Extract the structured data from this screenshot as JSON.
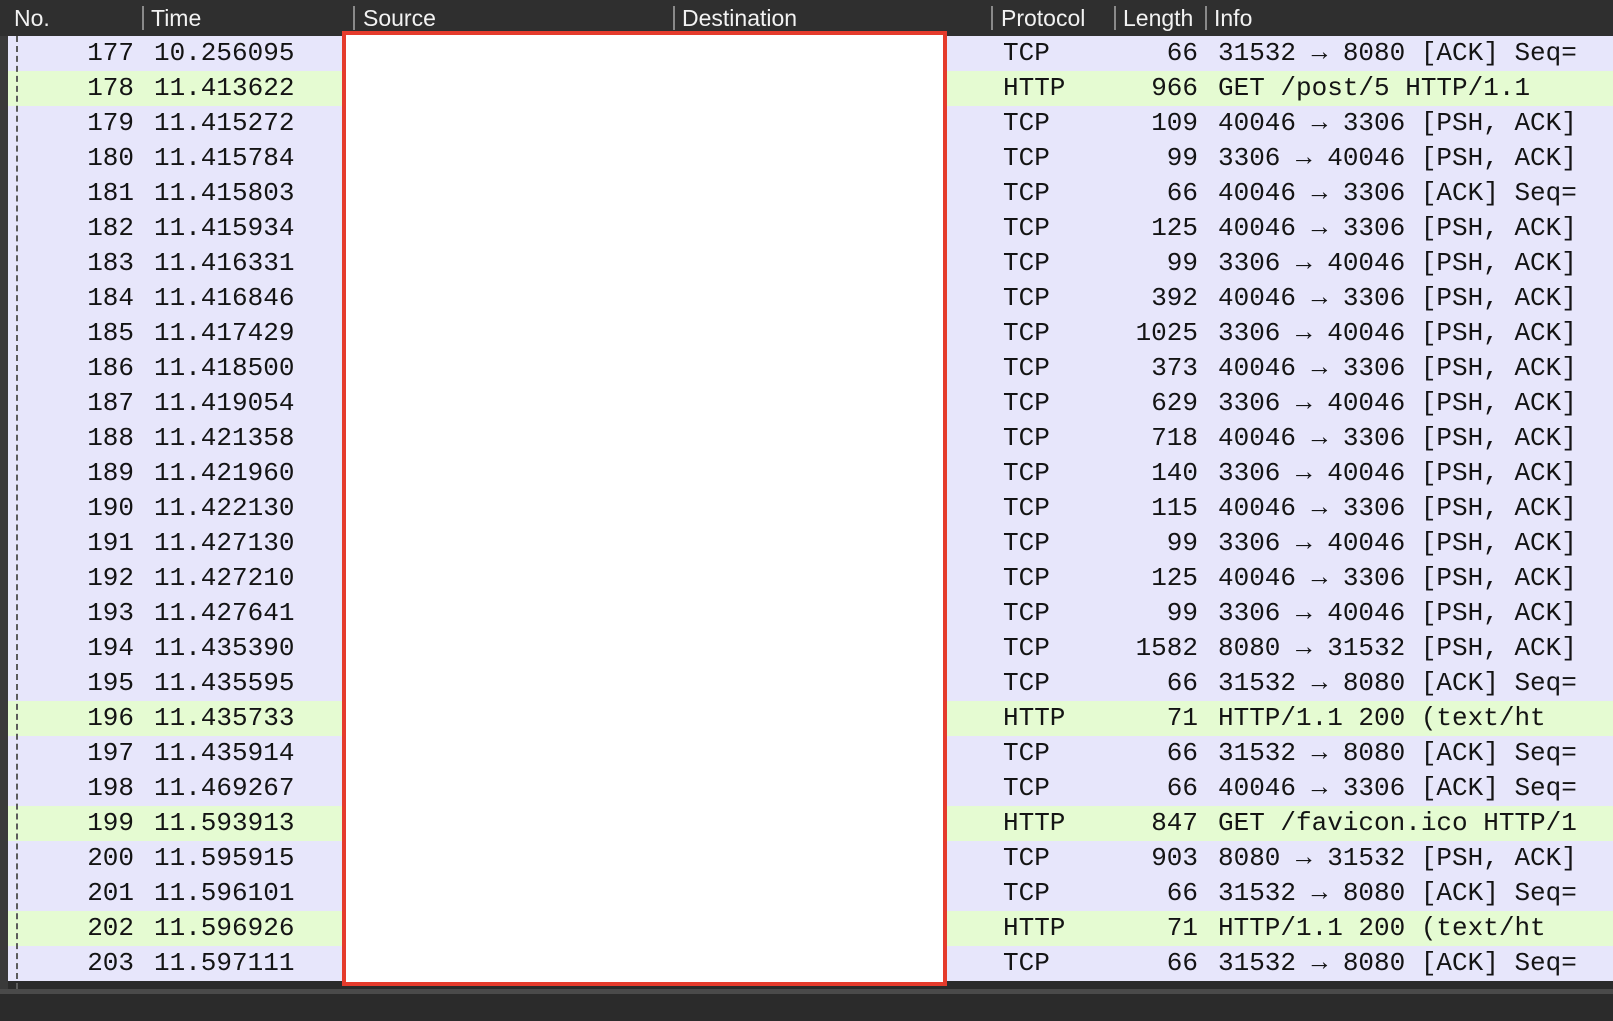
{
  "columns": {
    "no": "No.",
    "time": "Time",
    "source": "Source",
    "destination": "Destination",
    "protocol": "Protocol",
    "length": "Length",
    "info": "Info"
  },
  "colors": {
    "tcp_row": "#e7e6fb",
    "http_row": "#e5fbd2",
    "redaction_border": "#e53b2c"
  },
  "packets": [
    {
      "no": "177",
      "time": "10.256095",
      "protocol": "TCP",
      "length": "66",
      "info": "31532 → 8080 [ACK] Seq="
    },
    {
      "no": "178",
      "time": "11.413622",
      "protocol": "HTTP",
      "length": "966",
      "info": "GET /post/5 HTTP/1.1"
    },
    {
      "no": "179",
      "time": "11.415272",
      "protocol": "TCP",
      "length": "109",
      "info": "40046 → 3306 [PSH, ACK]"
    },
    {
      "no": "180",
      "time": "11.415784",
      "protocol": "TCP",
      "length": "99",
      "info": "3306 → 40046 [PSH, ACK]"
    },
    {
      "no": "181",
      "time": "11.415803",
      "protocol": "TCP",
      "length": "66",
      "info": "40046 → 3306 [ACK] Seq="
    },
    {
      "no": "182",
      "time": "11.415934",
      "protocol": "TCP",
      "length": "125",
      "info": "40046 → 3306 [PSH, ACK]"
    },
    {
      "no": "183",
      "time": "11.416331",
      "protocol": "TCP",
      "length": "99",
      "info": "3306 → 40046 [PSH, ACK]"
    },
    {
      "no": "184",
      "time": "11.416846",
      "protocol": "TCP",
      "length": "392",
      "info": "40046 → 3306 [PSH, ACK]"
    },
    {
      "no": "185",
      "time": "11.417429",
      "protocol": "TCP",
      "length": "1025",
      "info": "3306 → 40046 [PSH, ACK]"
    },
    {
      "no": "186",
      "time": "11.418500",
      "protocol": "TCP",
      "length": "373",
      "info": "40046 → 3306 [PSH, ACK]"
    },
    {
      "no": "187",
      "time": "11.419054",
      "protocol": "TCP",
      "length": "629",
      "info": "3306 → 40046 [PSH, ACK]"
    },
    {
      "no": "188",
      "time": "11.421358",
      "protocol": "TCP",
      "length": "718",
      "info": "40046 → 3306 [PSH, ACK]"
    },
    {
      "no": "189",
      "time": "11.421960",
      "protocol": "TCP",
      "length": "140",
      "info": "3306 → 40046 [PSH, ACK]"
    },
    {
      "no": "190",
      "time": "11.422130",
      "protocol": "TCP",
      "length": "115",
      "info": "40046 → 3306 [PSH, ACK]"
    },
    {
      "no": "191",
      "time": "11.427130",
      "protocol": "TCP",
      "length": "99",
      "info": "3306 → 40046 [PSH, ACK]"
    },
    {
      "no": "192",
      "time": "11.427210",
      "protocol": "TCP",
      "length": "125",
      "info": "40046 → 3306 [PSH, ACK]"
    },
    {
      "no": "193",
      "time": "11.427641",
      "protocol": "TCP",
      "length": "99",
      "info": "3306 → 40046 [PSH, ACK]"
    },
    {
      "no": "194",
      "time": "11.435390",
      "protocol": "TCP",
      "length": "1582",
      "info": "8080 → 31532 [PSH, ACK]"
    },
    {
      "no": "195",
      "time": "11.435595",
      "protocol": "TCP",
      "length": "66",
      "info": "31532 → 8080 [ACK] Seq="
    },
    {
      "no": "196",
      "time": "11.435733",
      "protocol": "HTTP",
      "length": "71",
      "info": "HTTP/1.1 200   (text/ht"
    },
    {
      "no": "197",
      "time": "11.435914",
      "protocol": "TCP",
      "length": "66",
      "info": "31532 → 8080 [ACK] Seq="
    },
    {
      "no": "198",
      "time": "11.469267",
      "protocol": "TCP",
      "length": "66",
      "info": "40046 → 3306 [ACK] Seq="
    },
    {
      "no": "199",
      "time": "11.593913",
      "protocol": "HTTP",
      "length": "847",
      "info": "GET /favicon.ico HTTP/1"
    },
    {
      "no": "200",
      "time": "11.595915",
      "protocol": "TCP",
      "length": "903",
      "info": "8080 → 31532 [PSH, ACK]"
    },
    {
      "no": "201",
      "time": "11.596101",
      "protocol": "TCP",
      "length": "66",
      "info": "31532 → 8080 [ACK] Seq="
    },
    {
      "no": "202",
      "time": "11.596926",
      "protocol": "HTTP",
      "length": "71",
      "info": "HTTP/1.1 200   (text/ht"
    },
    {
      "no": "203",
      "time": "11.597111",
      "protocol": "TCP",
      "length": "66",
      "info": "31532 → 8080 [ACK] Seq="
    }
  ]
}
